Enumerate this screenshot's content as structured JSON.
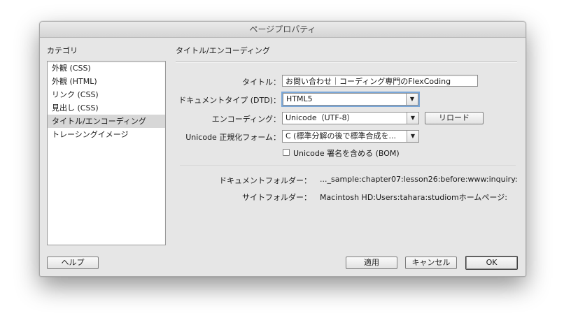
{
  "window": {
    "title": "ページプロパティ"
  },
  "category": {
    "heading": "カテゴリ",
    "items": [
      {
        "label": "外観 (CSS)",
        "selected": false
      },
      {
        "label": "外観 (HTML)",
        "selected": false
      },
      {
        "label": "リンク (CSS)",
        "selected": false
      },
      {
        "label": "見出し (CSS)",
        "selected": false
      },
      {
        "label": "タイトル/エンコーディング",
        "selected": true
      },
      {
        "label": "トレーシングイメージ",
        "selected": false
      }
    ]
  },
  "panel": {
    "title": "タイトル/エンコーディング",
    "title_label": "タイトル：",
    "title_value": "お問い合わせ｜コーディング専門のFlexCoding",
    "doctype_label": "ドキュメントタイプ (DTD)：",
    "doctype_value": "HTML5",
    "encoding_label": "エンコーディング：",
    "encoding_value": "Unicode（UTF-8）",
    "reload_button": "リロード",
    "normalization_label": "Unicode 正規化フォーム：",
    "normalization_value": "C (標準分解の後で標準合成を...",
    "bom_checkbox_label": "Unicode 署名を含める (BOM)",
    "bom_checked": false,
    "doc_folder_label": "ドキュメントフォルダー：",
    "doc_folder_value": "..._sample:chapter07:lesson26:before:www:inquiry:",
    "site_folder_label": "サイトフォルダー：",
    "site_folder_value": "Macintosh HD:Users:tahara:studiomホームページ:"
  },
  "buttons": {
    "help": "ヘルプ",
    "apply": "適用",
    "cancel": "キャンセル",
    "ok": "OK"
  },
  "icons": {
    "dropdown": "chevron-down-icon"
  }
}
